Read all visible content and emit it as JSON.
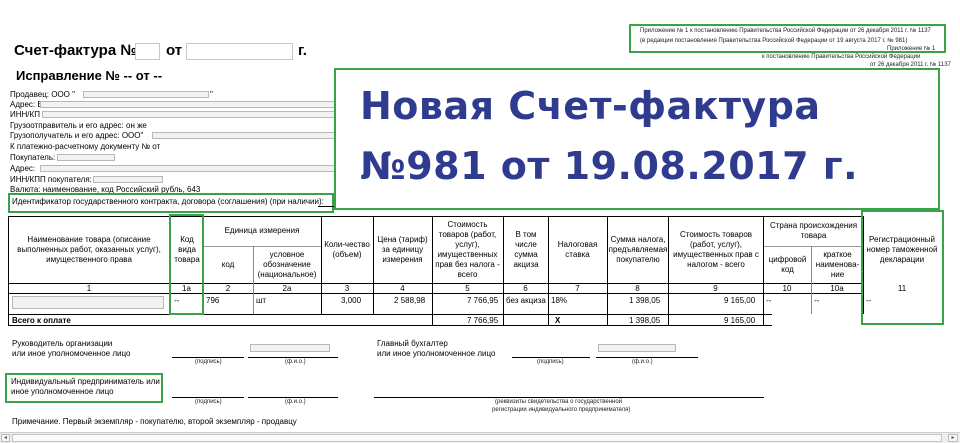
{
  "header": {
    "appendix_line1": "Приложение № 1 к постановлению Правительства Российской Федерации от 26 декабря 2011 г. № 1137",
    "appendix_line2": "(в редакции постановления Правительства Российской Федерации от 19 августа 2017 г. № 981)",
    "appendix_no": "Приложение № 1",
    "appendix_decree": "к постановлению Правительства Российской Федерации",
    "appendix_date": "от 26 декабря 2011 г. № 1137"
  },
  "title": {
    "invoice_prefix": "Счет-фактура №",
    "from": "от",
    "year_suffix": "г.",
    "correction": "Исправление № -- от --"
  },
  "overlay": {
    "line1": "Новая Счет-фактура",
    "line2": "№981 от 19.08.2017 г."
  },
  "fields": {
    "seller": "Продавец: ООО \"",
    "seller_end": "\"",
    "address": "Адрес: Е",
    "inn": "ИНН/КП",
    "shipper": "Грузоотправитель и его адрес: он же",
    "consignee": "Грузополучатель и его адрес: ООО\"",
    "payment_doc": "К платежно-расчетному документу №    от",
    "buyer": "Покупатель:",
    "buyer_address": "Адрес:",
    "buyer_inn": "ИНН/КПП покупателя:",
    "currency": "Валюта: наименование, код Российский рубль, 643",
    "contract_id": "Идентификатор государственного контракта, договора (соглашения) (при наличии):"
  },
  "table": {
    "headers": {
      "name": "Наименование товара (описание выполненных работ, оказанных услуг), имущественного права",
      "kind_code": "Код вида товара",
      "unit": "Единица измерения",
      "unit_code": "код",
      "unit_symbol": "условное обозначение (национальное)",
      "qty": "Коли-чество (объем)",
      "price": "Цена (тариф) за единицу измерения",
      "cost_no_tax": "Стоимость товаров (работ, услуг), имущественных прав без налога - всего",
      "excise": "В том числе сумма акциза",
      "tax_rate": "Налоговая ставка",
      "tax_sum": "Сумма налога, предъявляемая покупателю",
      "cost_with_tax": "Стоимость товаров (работ, услуг), имущественных прав с налогом - всего",
      "country": "Страна происхождения товара",
      "country_code": "цифровой код",
      "country_name": "краткое наименова-ние",
      "customs": "Регистрационный номер таможенной декларации"
    },
    "numbers": [
      "1",
      "1а",
      "2",
      "2а",
      "3",
      "4",
      "5",
      "6",
      "7",
      "8",
      "9",
      "10",
      "10а",
      "11"
    ],
    "row": {
      "kind_code": "--",
      "unit_code": "796",
      "unit_symbol": "шт",
      "qty": "3,000",
      "price": "2 588,98",
      "cost_no_tax": "7 766,95",
      "excise": "без акциза",
      "tax_rate": "18%",
      "tax_sum": "1 398,05",
      "cost_with_tax": "9 165,00",
      "country_code": "--",
      "country_name": "--",
      "customs": "--"
    },
    "total": {
      "label": "Всего к оплате",
      "cost_no_tax": "7 766,95",
      "excise": "X",
      "tax_sum": "1 398,05",
      "cost_with_tax": "9 165,00"
    }
  },
  "signatures": {
    "head": "Руководитель организации",
    "head2": "или иное уполномоченное лицо",
    "accountant": "Главный бухгалтер",
    "accountant2": "или иное уполномоченное лицо",
    "sign_caption": "(подпись)",
    "name_caption": "(ф.и.о.)",
    "entrepreneur": "Индивидуальный предприниматель или",
    "entrepreneur2": "иное уполномоченное лицо",
    "cert_caption1": "(реквизиты свидетельства о государственной",
    "cert_caption2": "регистрации индивидуального предпринимателя)",
    "note": "Примечание. Первый экземпляр - покупателю, второй экземпляр - продавцу"
  }
}
